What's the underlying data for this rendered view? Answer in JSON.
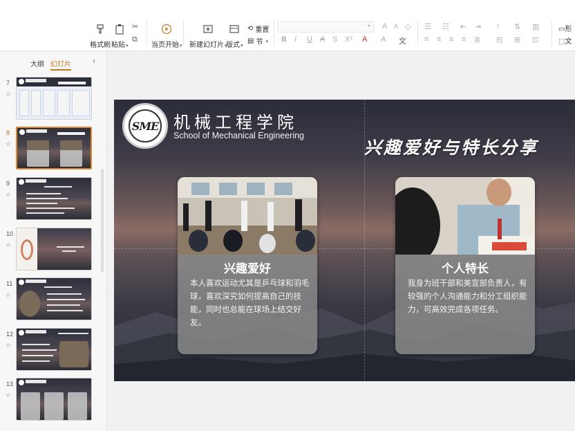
{
  "ribbon": {
    "format_painter": "格式刷",
    "paste": "粘贴",
    "play_from_current": "当页开始",
    "new_slide": "新建幻灯片",
    "layout": "版式",
    "reset": "重置",
    "section": "节",
    "font_size_up": "A",
    "font_size_down": "A",
    "bold": "B",
    "italic": "I",
    "underline": "U",
    "strikethrough": "A",
    "shadow": "S",
    "superscript": "X²",
    "font_color": "A",
    "highlight": "A",
    "more_text": "文",
    "right_label_top": "形",
    "right_label_bottom": "文"
  },
  "sidebar": {
    "tab_outline": "大纲",
    "tab_slides": "幻灯片",
    "collapse": "‹",
    "thumbnails": [
      {
        "num": "7"
      },
      {
        "num": "8"
      },
      {
        "num": "9"
      },
      {
        "num": "10"
      },
      {
        "num": "11"
      },
      {
        "num": "12"
      },
      {
        "num": "13"
      }
    ]
  },
  "slide": {
    "logo_text": "SME",
    "school_cn": "机械工程学院",
    "school_en": "School of Mechanical Engineering",
    "heading": "兴趣爱好与特长分享",
    "cards": [
      {
        "title": "兴趣爱好",
        "text": "本人喜欢运动尤其是乒乓球和羽毛球，喜欢深究如何提高自己的技能，同时也总能在球场上结交好友。"
      },
      {
        "title": "个人特长",
        "text": "我身为班干部和美宣部负责人，有较强的个人沟通能力和分工组织能力，可高效完成各项任务。"
      }
    ]
  }
}
